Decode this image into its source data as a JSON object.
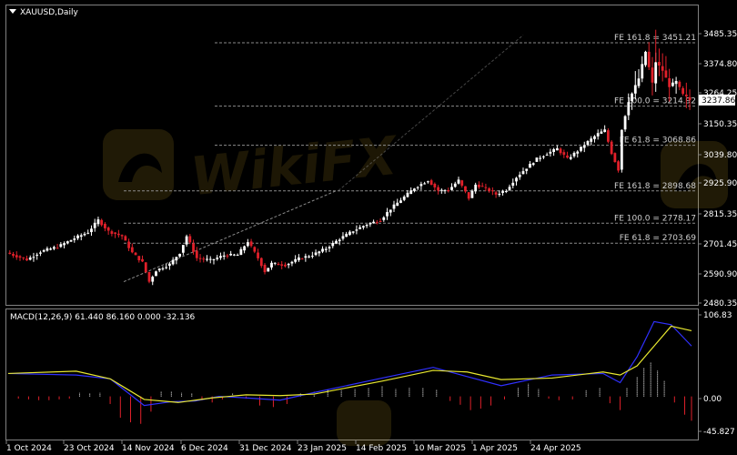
{
  "symbol_title": "XAUUSD,Daily",
  "macd_label": "MACD(12,26,9) 61.440 86.160 0.000 -32.136",
  "watermark": "WikiFX",
  "colors": {
    "background": "#000000",
    "bull": "#ffffff",
    "bear": "#e0202a",
    "macd_line": "#3030ff",
    "signal_line": "#e8e830",
    "fib_line": "#8a8a8a",
    "price_tag_bg": "#ffffff"
  },
  "chart_data": {
    "type": "candlestick",
    "price_axis": {
      "ylim": [
        2480.35,
        3540
      ],
      "ticks": [
        "3485.35",
        "3374.80",
        "3264.25",
        "3150.35",
        "3039.80",
        "2925.90",
        "2815.35",
        "2701.45",
        "2590.90",
        "2480.35"
      ]
    },
    "current_price": "3237.86",
    "x_tick_labels": [
      "1 Oct 2024",
      "23 Oct 2024",
      "14 Nov 2024",
      "6 Dec 2024",
      "31 Dec 2024",
      "23 Jan 2025",
      "14 Feb 2025",
      "10 Mar 2025",
      "1 Apr 2025",
      "24 Apr 2025"
    ],
    "fib_levels": [
      {
        "label": "FE 161.8 = 3451.21",
        "value": 3451.21
      },
      {
        "label": "FE 100.0 = 3214.92",
        "value": 3214.92
      },
      {
        "label": "FE 61.8 = 3068.86",
        "value": 3068.86
      },
      {
        "label": "FE 161.8 = 2898.68",
        "value": 2898.68
      },
      {
        "label": "FE 100.0 = 2778.17",
        "value": 2778.17
      },
      {
        "label": "FE 61.8 = 2703.69",
        "value": 2703.69
      }
    ],
    "price_path": [
      [
        0,
        2668
      ],
      [
        6,
        2642
      ],
      [
        10,
        2672
      ],
      [
        15,
        2690
      ],
      [
        20,
        2722
      ],
      [
        24,
        2745
      ],
      [
        27,
        2790
      ],
      [
        30,
        2748
      ],
      [
        34,
        2730
      ],
      [
        37,
        2668
      ],
      [
        40,
        2632
      ],
      [
        42,
        2560
      ],
      [
        44,
        2602
      ],
      [
        48,
        2625
      ],
      [
        51,
        2668
      ],
      [
        53,
        2730
      ],
      [
        56,
        2648
      ],
      [
        60,
        2640
      ],
      [
        64,
        2658
      ],
      [
        68,
        2660
      ],
      [
        71,
        2710
      ],
      [
        74,
        2648
      ],
      [
        76,
        2598
      ],
      [
        78,
        2628
      ],
      [
        82,
        2622
      ],
      [
        86,
        2646
      ],
      [
        90,
        2660
      ],
      [
        94,
        2684
      ],
      [
        98,
        2720
      ],
      [
        102,
        2750
      ],
      [
        106,
        2774
      ],
      [
        110,
        2790
      ],
      [
        113,
        2832
      ],
      [
        117,
        2876
      ],
      [
        120,
        2910
      ],
      [
        124,
        2938
      ],
      [
        127,
        2900
      ],
      [
        130,
        2902
      ],
      [
        133,
        2938
      ],
      [
        136,
        2872
      ],
      [
        138,
        2922
      ],
      [
        141,
        2908
      ],
      [
        144,
        2886
      ],
      [
        147,
        2902
      ],
      [
        150,
        2950
      ],
      [
        153,
        2985
      ],
      [
        156,
        3018
      ],
      [
        159,
        3038
      ],
      [
        162,
        3056
      ],
      [
        165,
        3018
      ],
      [
        168,
        3048
      ],
      [
        171,
        3082
      ],
      [
        174,
        3112
      ],
      [
        176,
        3125
      ],
      [
        178,
        3040
      ],
      [
        180,
        2978
      ],
      [
        181,
        3128
      ],
      [
        183,
        3234
      ],
      [
        186,
        3318
      ],
      [
        188,
        3418
      ],
      [
        190,
        3300
      ],
      [
        191,
        3380
      ],
      [
        193,
        3348
      ],
      [
        195,
        3290
      ],
      [
        197,
        3306
      ],
      [
        199,
        3258
      ],
      [
        201,
        3238
      ]
    ],
    "macd": {
      "ylim": [
        -45.827,
        106.83
      ],
      "ticks": [
        "106.83",
        "0.00",
        "-45.827"
      ],
      "line": [
        [
          0,
          30
        ],
        [
          20,
          28
        ],
        [
          30,
          23
        ],
        [
          40,
          -12
        ],
        [
          48,
          -7
        ],
        [
          55,
          -6
        ],
        [
          62,
          0
        ],
        [
          70,
          -2
        ],
        [
          80,
          -5
        ],
        [
          90,
          5
        ],
        [
          110,
          24
        ],
        [
          125,
          38
        ],
        [
          135,
          26
        ],
        [
          145,
          14
        ],
        [
          160,
          28
        ],
        [
          175,
          30
        ],
        [
          180,
          18
        ],
        [
          185,
          52
        ],
        [
          190,
          98
        ],
        [
          195,
          94
        ],
        [
          201,
          66
        ]
      ],
      "signal": [
        [
          0,
          30
        ],
        [
          20,
          33
        ],
        [
          30,
          23
        ],
        [
          40,
          -4
        ],
        [
          50,
          -8
        ],
        [
          60,
          -2
        ],
        [
          70,
          2
        ],
        [
          80,
          1
        ],
        [
          90,
          3
        ],
        [
          110,
          20
        ],
        [
          125,
          34
        ],
        [
          135,
          32
        ],
        [
          145,
          22
        ],
        [
          160,
          24
        ],
        [
          175,
          32
        ],
        [
          180,
          28
        ],
        [
          185,
          40
        ],
        [
          190,
          66
        ],
        [
          195,
          92
        ],
        [
          201,
          86
        ]
      ],
      "histogram": [
        [
          3,
          -3
        ],
        [
          6,
          -4
        ],
        [
          9,
          -5
        ],
        [
          12,
          -5
        ],
        [
          15,
          -4
        ],
        [
          18,
          -3
        ],
        [
          21,
          5
        ],
        [
          24,
          4
        ],
        [
          27,
          5
        ],
        [
          30,
          -10
        ],
        [
          33,
          -28
        ],
        [
          36,
          -34
        ],
        [
          39,
          -36
        ],
        [
          42,
          -20
        ],
        [
          45,
          6
        ],
        [
          48,
          6
        ],
        [
          51,
          5
        ],
        [
          54,
          4
        ],
        [
          57,
          -5
        ],
        [
          60,
          -8
        ],
        [
          63,
          -4
        ],
        [
          66,
          4
        ],
        [
          70,
          -3
        ],
        [
          74,
          -12
        ],
        [
          78,
          -14
        ],
        [
          82,
          -10
        ],
        [
          86,
          4
        ],
        [
          90,
          7
        ],
        [
          94,
          9
        ],
        [
          98,
          8
        ],
        [
          102,
          10
        ],
        [
          106,
          11
        ],
        [
          110,
          13
        ],
        [
          114,
          10
        ],
        [
          118,
          12
        ],
        [
          122,
          11
        ],
        [
          126,
          9
        ],
        [
          130,
          -6
        ],
        [
          133,
          -11
        ],
        [
          136,
          -18
        ],
        [
          139,
          -16
        ],
        [
          142,
          -12
        ],
        [
          146,
          -4
        ],
        [
          150,
          12
        ],
        [
          153,
          17
        ],
        [
          156,
          10
        ],
        [
          159,
          -3
        ],
        [
          162,
          -5
        ],
        [
          166,
          -4
        ],
        [
          170,
          8
        ],
        [
          174,
          11
        ],
        [
          177,
          -9
        ],
        [
          180,
          -18
        ],
        [
          182,
          11
        ],
        [
          185,
          26
        ],
        [
          187,
          37
        ],
        [
          189,
          45
        ],
        [
          191,
          34
        ],
        [
          193,
          20
        ],
        [
          196,
          -8
        ],
        [
          199,
          -24
        ],
        [
          201,
          -32
        ]
      ]
    }
  }
}
